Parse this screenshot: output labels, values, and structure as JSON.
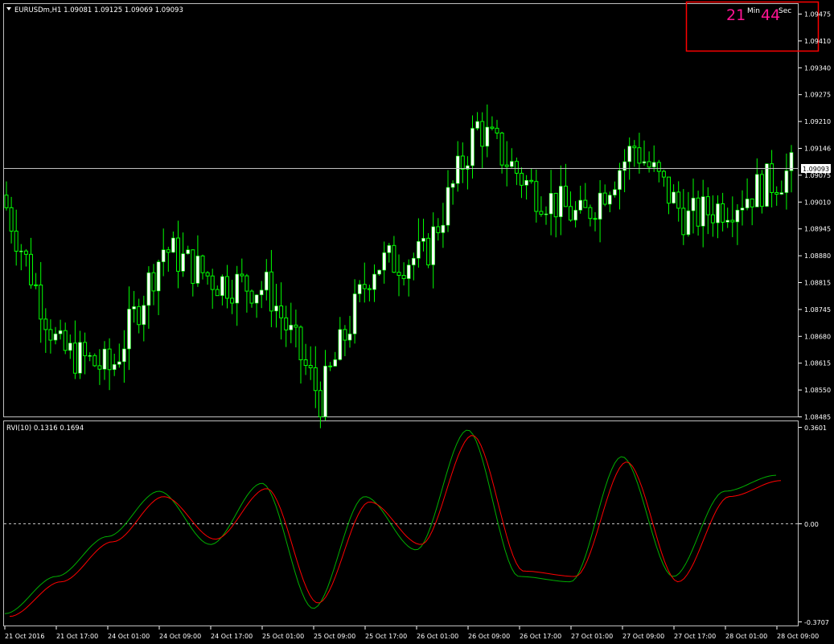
{
  "header": {
    "symbol_line": "EURUSDm,H1  1.09081 1.09125 1.09069 1.09093"
  },
  "timer": {
    "minutes": "21",
    "min_label": "Min",
    "seconds": "44",
    "sec_label": "Sec",
    "box_color": "#ff0000",
    "digit_color": "#ff1493"
  },
  "price_axis": {
    "ticks": [
      "1.09475",
      "1.09410",
      "1.09340",
      "1.09275",
      "1.09210",
      "1.09146",
      "1.09075",
      "1.09010",
      "1.08945",
      "1.08880",
      "1.08815",
      "1.08745",
      "1.08680",
      "1.08615",
      "1.08550",
      "1.08485"
    ],
    "current_price": "1.09093"
  },
  "indicator": {
    "label": "RVI(10) 0.1316 0.1694",
    "ticks": [
      "0.3601",
      "0.00",
      "-0.3707"
    ]
  },
  "time_axis": {
    "labels": [
      "21 Oct 2016",
      "21 Oct 17:00",
      "24 Oct 01:00",
      "24 Oct 09:00",
      "24 Oct 17:00",
      "25 Oct 01:00",
      "25 Oct 09:00",
      "25 Oct 17:00",
      "26 Oct 01:00",
      "26 Oct 09:00",
      "26 Oct 17:00",
      "27 Oct 01:00",
      "27 Oct 09:00",
      "27 Oct 17:00",
      "28 Oct 01:00",
      "28 Oct 09:00"
    ]
  },
  "colors": {
    "background": "#000000",
    "up_candle": "#ffffff",
    "wick": "#00ff00",
    "rvi_main": "#00c000",
    "rvi_signal": "#ff0000",
    "grid": "#c0c0c0"
  },
  "chart_data": [
    {
      "type": "candlestick",
      "title": "EURUSDm,H1",
      "ylim": [
        1.08485,
        1.09475
      ],
      "x": [
        "21 Oct 2016",
        "21 Oct 17:00",
        "24 Oct 01:00",
        "24 Oct 09:00",
        "24 Oct 17:00",
        "25 Oct 01:00",
        "25 Oct 09:00",
        "25 Oct 17:00",
        "26 Oct 01:00",
        "26 Oct 09:00",
        "26 Oct 17:00",
        "27 Oct 01:00",
        "27 Oct 09:00",
        "27 Oct 17:00",
        "28 Oct 01:00",
        "28 Oct 09:00"
      ],
      "close": [
        1.09,
        1.0865,
        1.086,
        1.089,
        1.0882,
        1.088,
        1.0853,
        1.0886,
        1.0888,
        1.092,
        1.0905,
        1.0897,
        1.0915,
        1.0897,
        1.0902,
        1.0909
      ],
      "current_price": 1.09093
    },
    {
      "type": "line",
      "title": "RVI(10)",
      "ylim": [
        -0.3707,
        0.3601
      ],
      "series": [
        {
          "name": "RVI",
          "values": [
            -0.34,
            -0.2,
            -0.05,
            0.12,
            -0.08,
            0.15,
            -0.32,
            0.1,
            -0.1,
            0.35,
            -0.2,
            -0.22,
            0.25,
            -0.2,
            0.12,
            0.18
          ]
        },
        {
          "name": "Signal",
          "values": [
            -0.35,
            -0.22,
            -0.07,
            0.1,
            -0.06,
            0.13,
            -0.3,
            0.08,
            -0.08,
            0.33,
            -0.18,
            -0.2,
            0.23,
            -0.22,
            0.1,
            0.16
          ]
        }
      ]
    }
  ]
}
